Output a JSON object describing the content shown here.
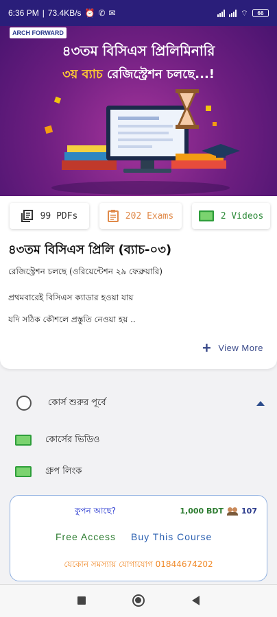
{
  "status_bar": {
    "time": "6:36 PM",
    "speed": "73.4KB/s",
    "battery": "66"
  },
  "banner": {
    "logo": "ARCH FORWARD",
    "title": "৪৩তম বিসিএস প্রিলিমিনারি",
    "subtitle_highlight": "৩য় ব্যাচ",
    "subtitle_rest": "রেজিস্ট্রেশন চলছে...!"
  },
  "badges": {
    "pdfs": "99 PDFs",
    "exams": "202 Exams",
    "videos": "2 Videos"
  },
  "course": {
    "title": "৪৩তম বিসিএস প্রিলি (ব্যাচ-০৩)",
    "line1": "রেজিস্ট্রেশন চলছে (ওরিয়েন্টেশন ২৯ ফেব্রুয়ারি)",
    "line2": "প্রথমবারেই বিসিএস ক্যাডার হওয়া যায়",
    "line3": "যদি সঠিক কৌশলে প্রস্তুতি নেওয়া হয় ..",
    "view_more": "View More"
  },
  "section": {
    "title": "কোর্স শুরুর পূর্বে",
    "items": [
      {
        "label": "কোর্সের ভিডিও"
      },
      {
        "label": "গ্রুপ লিংক"
      }
    ]
  },
  "purchase": {
    "coupon": "কুপন আছে?",
    "price": "1,000 BDT",
    "enrolled": "107",
    "free_access": "Free Access",
    "buy": "Buy This Course",
    "contact": "যেকোন সমস্যায় যোগাযোগ 01844674202"
  },
  "colors": {
    "status_bar": "#2a1e7a",
    "banner": "#6d1e80",
    "green": "#2e7d32",
    "blue": "#2a5fb0",
    "orange": "#f08a2a"
  },
  "icons": [
    "pdf-stack-icon",
    "exam-sheet-icon",
    "video-icon",
    "plus-icon",
    "caret-up-icon",
    "users-icon"
  ]
}
